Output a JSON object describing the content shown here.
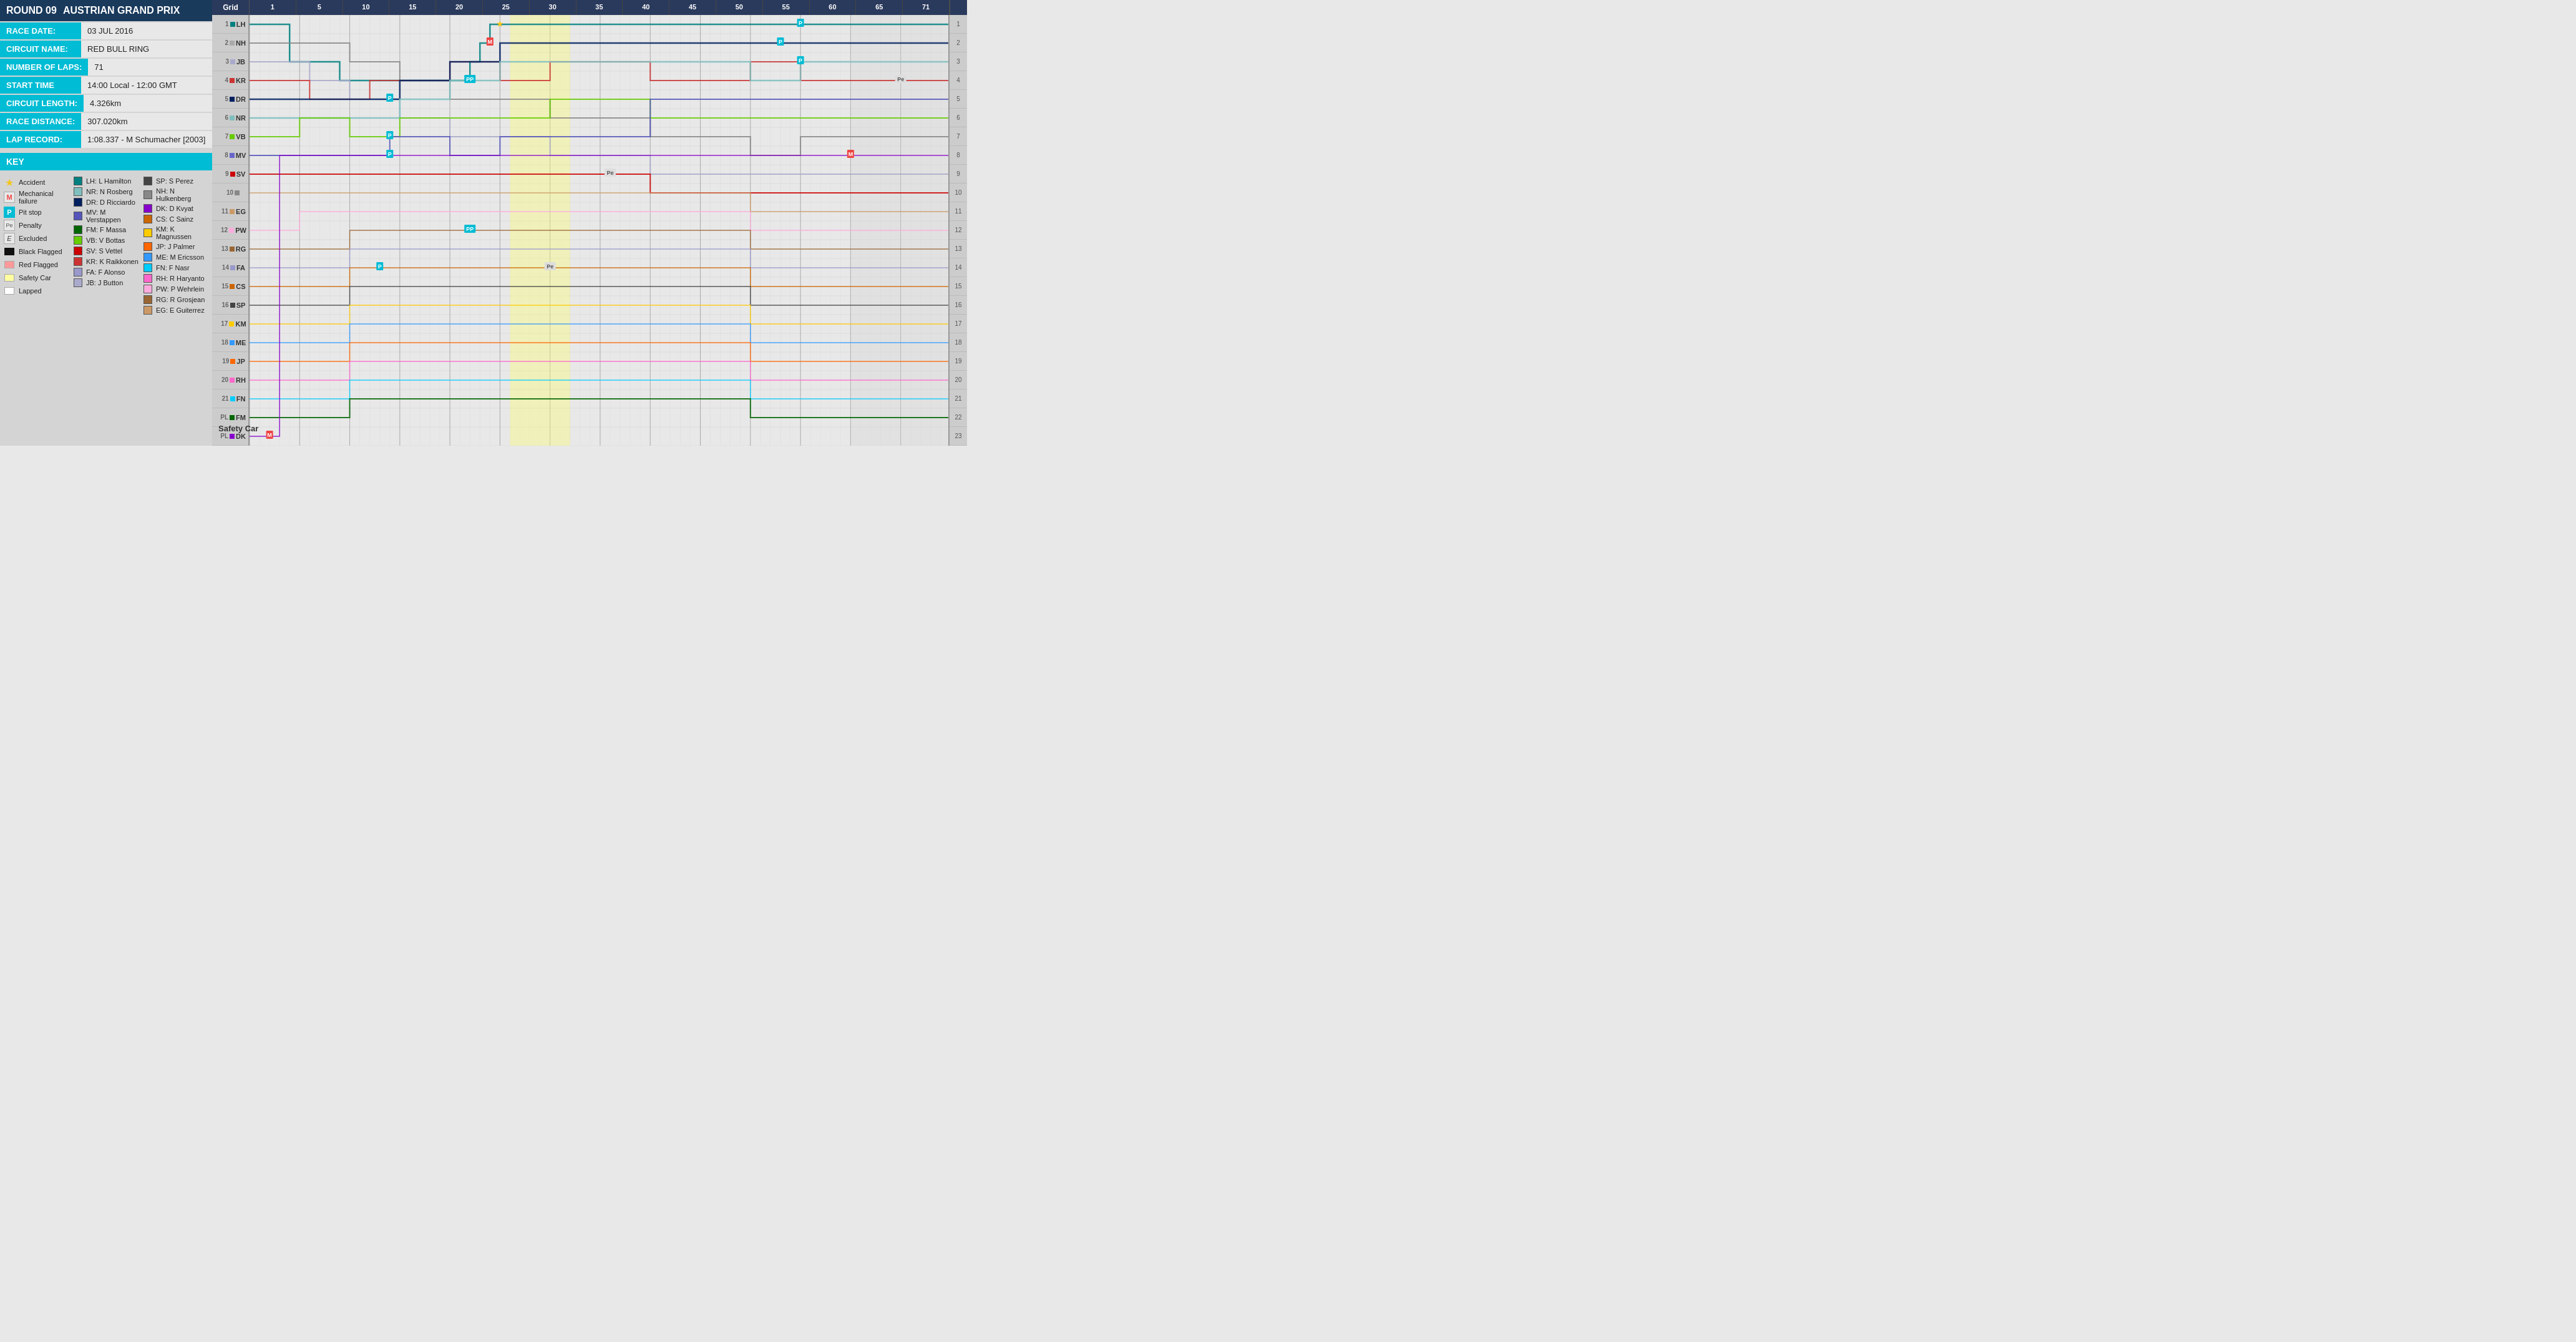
{
  "header": {
    "round_label": "ROUND 09",
    "race_name": "AUSTRIAN GRAND PRIX"
  },
  "info": {
    "race_date_label": "RACE DATE:",
    "race_date_value": "03 JUL 2016",
    "circuit_name_label": "CIRCUIT NAME:",
    "circuit_name_value": "RED BULL RING",
    "num_laps_label": "NUMBER OF LAPS:",
    "num_laps_value": "71",
    "start_time_label": "START TIME",
    "start_time_value": "14:00 Local - 12:00 GMT",
    "circuit_length_label": "CIRCUIT LENGTH:",
    "circuit_length_value": "4.326km",
    "race_distance_label": "RACE DISTANCE:",
    "race_distance_value": "307.020km",
    "lap_record_label": "LAP RECORD:",
    "lap_record_value": "1:08.337 - M Schumacher [2003]"
  },
  "key": {
    "title": "KEY",
    "symbols": [
      {
        "icon": "star",
        "label": "Accident"
      },
      {
        "icon": "M",
        "label": "Mechanical failure"
      },
      {
        "icon": "P",
        "label": "Pit stop"
      },
      {
        "icon": "Pe",
        "label": "Penalty"
      },
      {
        "icon": "E",
        "label": "Excluded"
      },
      {
        "icon": "black",
        "label": "Black Flagged"
      },
      {
        "icon": "red",
        "label": "Red Flagged"
      },
      {
        "icon": "yellow",
        "label": "Safety Car"
      },
      {
        "icon": "white",
        "label": "Lapped"
      }
    ],
    "drivers_col1": [
      {
        "color": "#008080",
        "label": "LH: L Hamilton"
      },
      {
        "color": "#7fbfbf",
        "label": "NR: N Rosberg"
      },
      {
        "color": "#002060",
        "label": "DR: D Ricciardo"
      },
      {
        "color": "#6666cc",
        "label": "MV: M Verstappen"
      },
      {
        "color": "#006600",
        "label": "FM: F Massa"
      },
      {
        "color": "#66cc00",
        "label": "VB: V Bottas"
      },
      {
        "color": "#cc0000",
        "label": "SV: S Vettel"
      },
      {
        "color": "#cc3333",
        "label": "KR: K Raikkonen"
      },
      {
        "color": "#9999cc",
        "label": "FA: F Alonso"
      },
      {
        "color": "#aaaacc",
        "label": "JB: J Button"
      }
    ],
    "drivers_col2": [
      {
        "color": "#444444",
        "label": "SP: S Perez"
      },
      {
        "color": "#888888",
        "label": "NH: N Hulkenberg"
      },
      {
        "color": "#8800cc",
        "label": "DK: D Kvyat"
      },
      {
        "color": "#cc6600",
        "label": "CS: C Sainz"
      },
      {
        "color": "#ffcc00",
        "label": "KM: K Magnussen"
      },
      {
        "color": "#ff6600",
        "label": "JP: J Palmer"
      },
      {
        "color": "#3399ff",
        "label": "ME: M Ericsson"
      },
      {
        "color": "#00ccff",
        "label": "FN: F Nasr"
      },
      {
        "color": "#ff66cc",
        "label": "RH: R Haryanto"
      },
      {
        "color": "#ffaadd",
        "label": "PW: P Wehrlein"
      },
      {
        "color": "#996633",
        "label": "RG: R Grosjean"
      },
      {
        "color": "#cc9966",
        "label": "EG: E Guiterrez"
      }
    ]
  },
  "chart": {
    "grid_label": "Grid",
    "lap_markers": [
      1,
      5,
      10,
      15,
      20,
      25,
      30,
      35,
      40,
      45,
      50,
      55,
      60,
      65,
      71
    ],
    "rows": [
      {
        "pos": "1",
        "abbr": "LH",
        "color": "#008080",
        "dot_color": "#008080"
      },
      {
        "pos": "2",
        "abbr": "NH",
        "color": "#7fbfbf",
        "dot_color": "#aaaaaa"
      },
      {
        "pos": "3",
        "abbr": "JB",
        "color": "#aaaacc",
        "dot_color": "#aaaacc"
      },
      {
        "pos": "4",
        "abbr": "KR",
        "color": "#cc3333",
        "dot_color": "#cc3333"
      },
      {
        "pos": "5",
        "abbr": "DR",
        "color": "#002060",
        "dot_color": "#002060"
      },
      {
        "pos": "6",
        "abbr": "NR",
        "color": "#7fbfbf",
        "dot_color": "#7fbfbf"
      },
      {
        "pos": "7",
        "abbr": "VB",
        "color": "#66cc00",
        "dot_color": "#66cc00"
      },
      {
        "pos": "8",
        "abbr": "MV",
        "color": "#6666cc",
        "dot_color": "#6666cc"
      },
      {
        "pos": "9",
        "abbr": "SV",
        "color": "#cc0000",
        "dot_color": "#cc0000"
      },
      {
        "pos": "10",
        "abbr": "",
        "color": "#888",
        "dot_color": "#888"
      },
      {
        "pos": "11",
        "abbr": "EG",
        "color": "#cc9966",
        "dot_color": "#cc9966"
      },
      {
        "pos": "12",
        "abbr": "PW",
        "color": "#ffaadd",
        "dot_color": "#ffaadd"
      },
      {
        "pos": "13",
        "abbr": "RG",
        "color": "#996633",
        "dot_color": "#996633"
      },
      {
        "pos": "14",
        "abbr": "FA",
        "color": "#9999cc",
        "dot_color": "#9999cc"
      },
      {
        "pos": "15",
        "abbr": "CS",
        "color": "#cc6600",
        "dot_color": "#cc6600"
      },
      {
        "pos": "16",
        "abbr": "SP",
        "color": "#444444",
        "dot_color": "#444444"
      },
      {
        "pos": "17",
        "abbr": "KM",
        "color": "#ffcc00",
        "dot_color": "#ffcc00"
      },
      {
        "pos": "18",
        "abbr": "ME",
        "color": "#3399ff",
        "dot_color": "#3399ff"
      },
      {
        "pos": "19",
        "abbr": "JP",
        "color": "#ff6600",
        "dot_color": "#ff6600"
      },
      {
        "pos": "20",
        "abbr": "RH",
        "color": "#ff66cc",
        "dot_color": "#ff66cc"
      },
      {
        "pos": "21",
        "abbr": "FN",
        "color": "#00ccff",
        "dot_color": "#00ccff"
      },
      {
        "pos": "PL",
        "abbr": "FM",
        "color": "#006600",
        "dot_color": "#006600"
      },
      {
        "pos": "PL",
        "abbr": "DK",
        "color": "#8800cc",
        "dot_color": "#8800cc"
      }
    ],
    "safety_car_label": "Safety Car"
  }
}
